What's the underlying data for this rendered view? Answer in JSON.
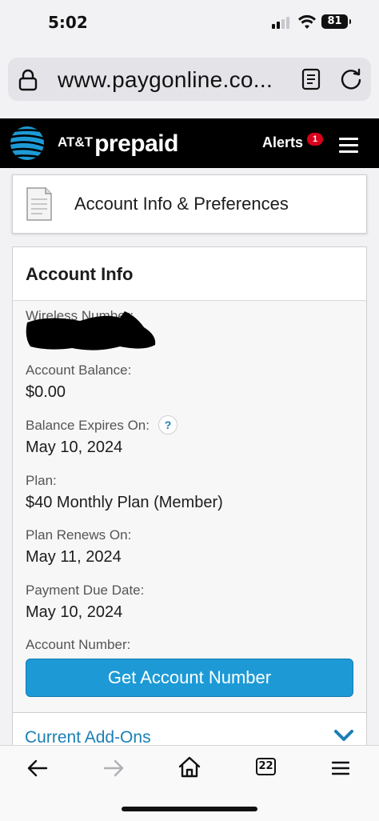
{
  "status_bar": {
    "time": "5:02",
    "battery": "81"
  },
  "browser": {
    "url": "www.paygonline.co..."
  },
  "header": {
    "brand_att": "AT&T",
    "brand_prepaid": "prepaid",
    "alerts_label": "Alerts",
    "alerts_count": "1"
  },
  "page": {
    "title": "Account Info & Preferences",
    "account_info": {
      "heading": "Account Info",
      "wireless_number_label": "Wireless Number:",
      "account_balance_label": "Account Balance:",
      "account_balance_value": "$0.00",
      "balance_expires_label": "Balance Expires On:",
      "balance_expires_help": "?",
      "balance_expires_value": "May 10, 2024",
      "plan_label": "Plan:",
      "plan_value": "$40 Monthly Plan (Member)",
      "plan_renews_label": "Plan Renews On:",
      "plan_renews_value": "May 11, 2024",
      "payment_due_label": "Payment Due Date:",
      "payment_due_value": "May 10, 2024",
      "account_number_label": "Account Number:",
      "get_account_number_button": "Get Account Number"
    },
    "current_addons": "Current Add-Ons"
  },
  "toolbar": {
    "tabs_count": "22"
  },
  "colors": {
    "header_bg": "#000000",
    "brand_blue": "#1d9ad6",
    "link_blue": "#1b7fb5",
    "alert_red": "#d9001b"
  }
}
